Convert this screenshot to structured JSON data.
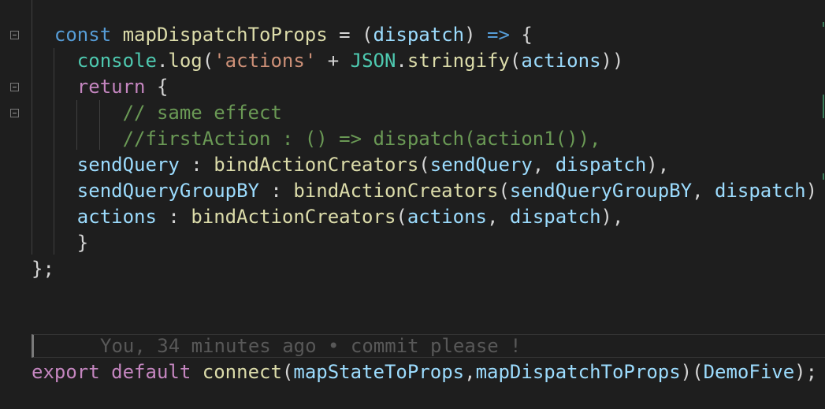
{
  "code": {
    "line1": {
      "t1": "const",
      "t2": "mapDispatchToProps",
      "t3": " = (",
      "t4": "dispatch",
      "t5": ") ",
      "t6": "=>",
      "t7": " {"
    },
    "line2": {
      "t1": "console",
      "t2": ".",
      "t3": "log",
      "t4": "(",
      "t5": "'actions'",
      "t6": " + ",
      "t7": "JSON",
      "t8": ".",
      "t9": "stringify",
      "t10": "(",
      "t11": "actions",
      "t12": "))"
    },
    "line3": {
      "t1": "return",
      "t2": " {"
    },
    "line4": {
      "t1": "// same effect"
    },
    "line5": {
      "t1": "//firstAction : () => dispatch(action1()),"
    },
    "line6": {
      "t1": "sendQuery",
      "t2": " : ",
      "t3": "bindActionCreators",
      "t4": "(",
      "t5": "sendQuery",
      "t6": ", ",
      "t7": "dispatch",
      "t8": "),"
    },
    "line7": {
      "t1": "sendQueryGroupBY",
      "t2": " : ",
      "t3": "bindActionCreators",
      "t4": "(",
      "t5": "sendQueryGroupBY",
      "t6": ", ",
      "t7": "dispatch",
      "t8": ")"
    },
    "line8": {
      "t1": "actions",
      "t2": " : ",
      "t3": "bindActionCreators",
      "t4": "(",
      "t5": "actions",
      "t6": ", ",
      "t7": "dispatch",
      "t8": "),"
    },
    "line9": {
      "t1": "}"
    },
    "line10": {
      "t1": "};"
    },
    "blame": "You, 34 minutes ago • commit please !",
    "line12": {
      "t1": "export",
      "t2": " ",
      "t3": "default",
      "t4": " ",
      "t5": "connect",
      "t6": "(",
      "t7": "mapStateToProps",
      "t8": ",",
      "t9": "mapDispatchToProps",
      "t10": ")(",
      "t11": "DemoFive",
      "t12": ");"
    }
  },
  "icons": {
    "fold": "fold-collapse-icon"
  },
  "colors": {
    "background": "#1e1e1e",
    "keyword": "#569cd6",
    "control_keyword": "#c586c0",
    "function": "#dcdcaa",
    "variable": "#9cdcfe",
    "class": "#4ec9b0",
    "string": "#ce9178",
    "comment": "#6a9955",
    "blame": "#585858"
  }
}
